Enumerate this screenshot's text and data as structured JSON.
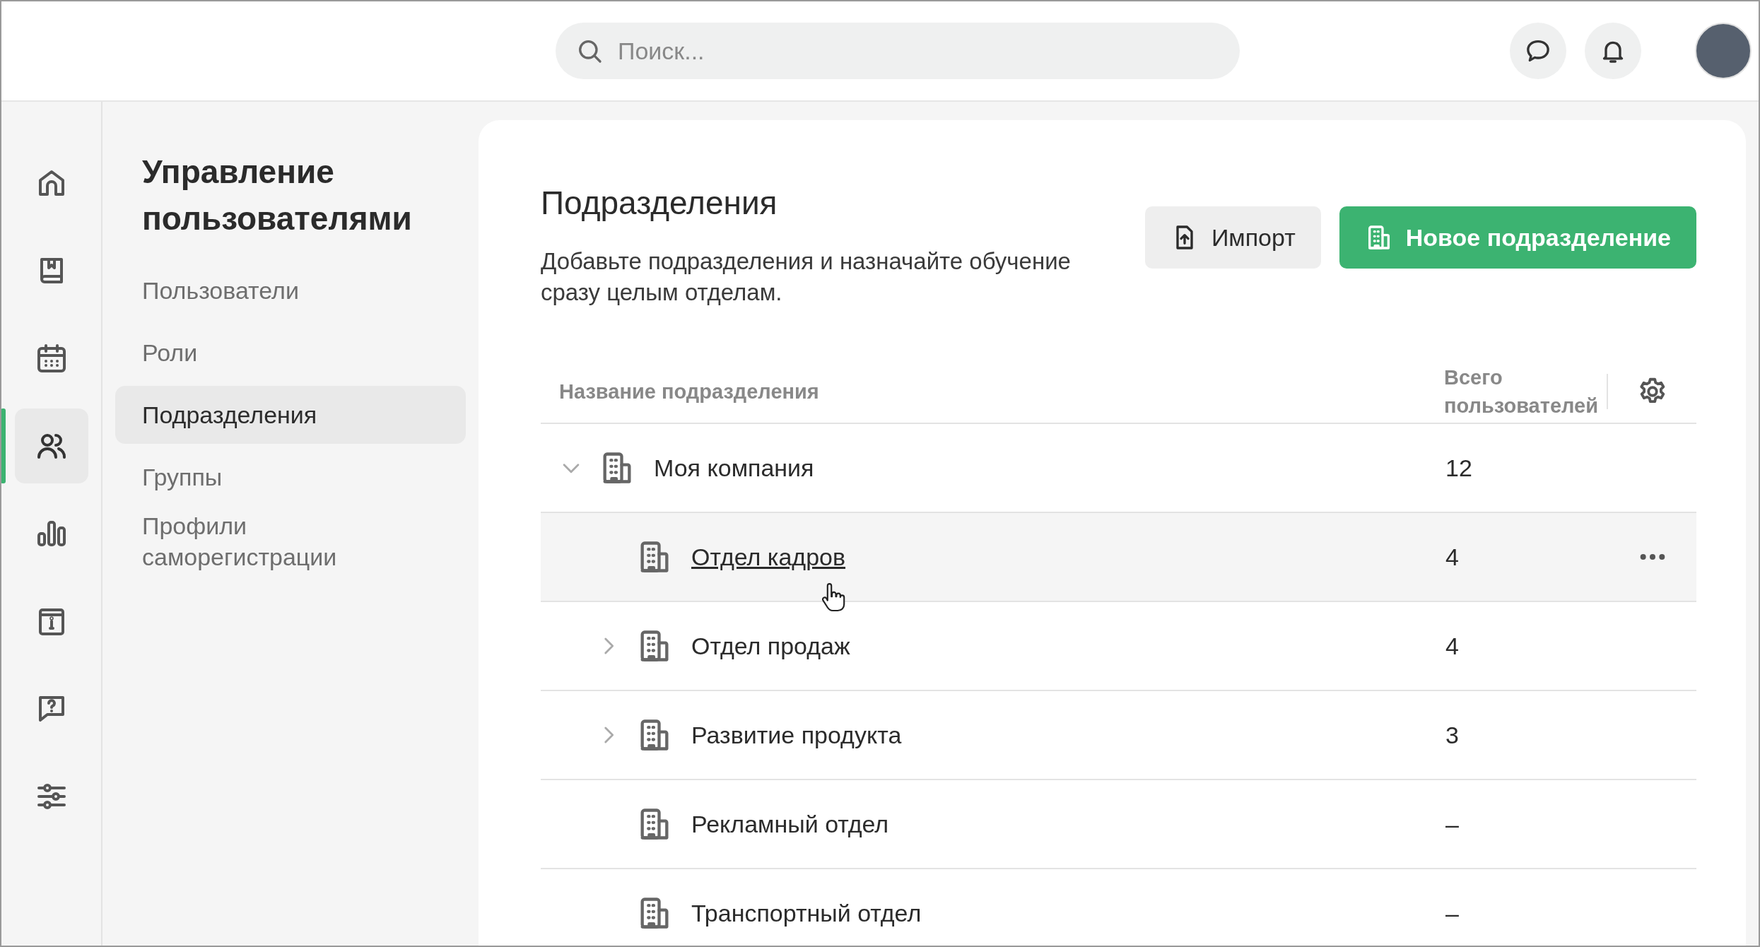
{
  "header": {
    "search": {
      "placeholder": "Поиск..."
    }
  },
  "rail": [
    {
      "selected": false
    },
    {
      "selected": false
    },
    {
      "selected": false
    },
    {
      "selected": true
    },
    {
      "selected": false
    },
    {
      "selected": false
    },
    {
      "selected": false
    },
    {
      "selected": false
    }
  ],
  "sidebar": {
    "title": "Управление пользователями",
    "items": [
      {
        "label": "Пользователи",
        "selected": false
      },
      {
        "label": "Роли",
        "selected": false
      },
      {
        "label": "Подразделения",
        "selected": true
      },
      {
        "label": "Группы",
        "selected": false
      },
      {
        "label": "Профили саморегистрации",
        "selected": false
      }
    ]
  },
  "page": {
    "title": "Подразделения",
    "description": "Добавьте подразделения и назначайте обучение сразу целым отделам.",
    "buttons": [
      {
        "label": "Импорт",
        "kind": "secondary"
      },
      {
        "label": "Новое подразделение",
        "kind": "primary"
      }
    ]
  },
  "table": {
    "columns": [
      "Название подразделения",
      "Всего пользователей"
    ],
    "rows": [
      {
        "name": "Моя компания",
        "total": "12",
        "expanded": true,
        "hovered": false,
        "children": [
          {
            "name": "Отдел кадров",
            "total": "4",
            "hovered": true
          },
          {
            "name": "Отдел продаж",
            "total": "4",
            "expanded": false,
            "hovered": false
          },
          {
            "name": "Развитие продукта",
            "total": "3",
            "expanded": false,
            "hovered": false
          },
          {
            "name": "Рекламный отдел",
            "total": "–",
            "hovered": false
          },
          {
            "name": "Транспортный отдел",
            "total": "–",
            "hovered": false
          }
        ]
      }
    ]
  }
}
